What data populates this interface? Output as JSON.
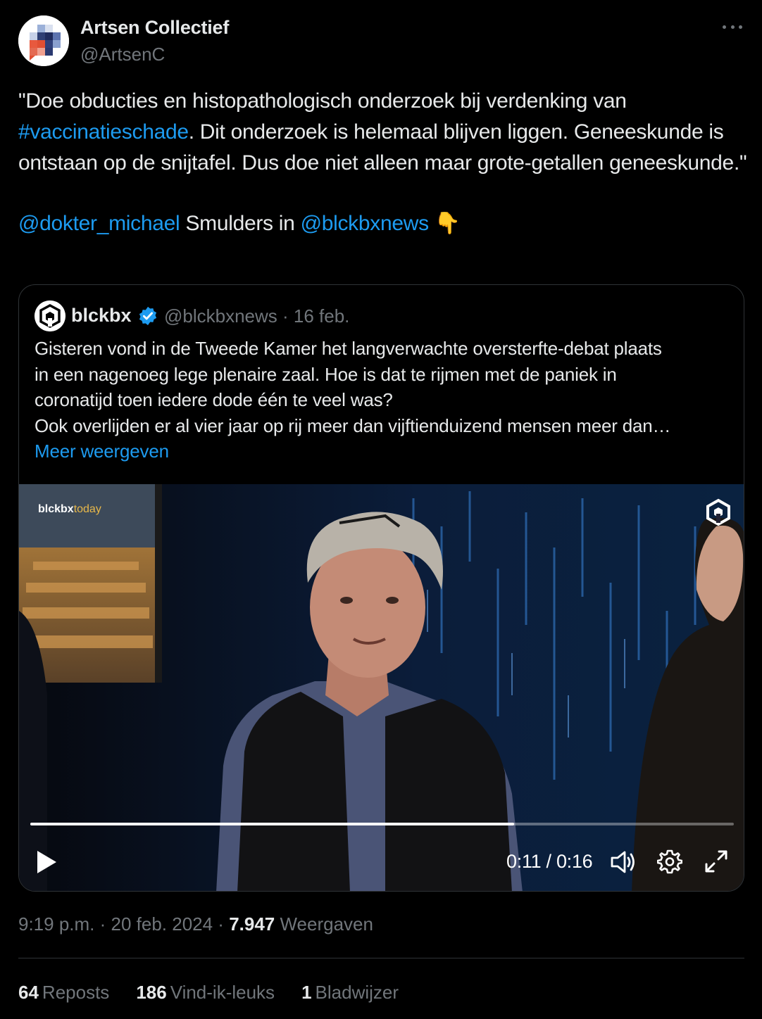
{
  "author": {
    "name": "Artsen Collectief",
    "handle": "@ArtsenC"
  },
  "tweet": {
    "text_before_tag": "\"Doe obducties en histopathologisch onderzoek bij verdenking van ",
    "hashtag": "#vaccinatieschade",
    "text_after_tag": ". Dit onderzoek is helemaal blijven liggen. Geneeskunde is ontstaan op de snijtafel. Dus doe niet alleen maar grote-getallen geneeskunde.\"",
    "mention_1": "@dokter_michael",
    "mention_mid": " Smulders in ",
    "mention_2": "@blckbxnews",
    "emoji": "👇"
  },
  "quoted": {
    "name": "blckbx",
    "handle_date": "@blckbxnews · 16 feb.",
    "lines": [
      "Gisteren vond in de Tweede Kamer het langverwachte oversterfte-debat plaats",
      "in een nagenoeg lege plenaire zaal. Hoe is dat te rijmen met de paniek in",
      "coronatijd toen iedere dode één te veel was?",
      "Ook overlijden er al vier jaar op rij meer dan vijftienduizend mensen meer dan…"
    ],
    "show_more": "Meer weergeven",
    "video": {
      "watermark_brand": "blckbx",
      "watermark_suffix": "today",
      "time": "0:11 / 0:16",
      "progress": 0.6875
    }
  },
  "meta": {
    "time": "9:19 p.m. · 20 feb. 2024 · ",
    "views_count": "7.947",
    "views_label": " Weergaven"
  },
  "stats": {
    "reposts_count": "64",
    "reposts_label": "Reposts",
    "likes_count": "186",
    "likes_label": "Vind-ik-leuks",
    "bookmarks_count": "1",
    "bookmarks_label": "Bladwijzer"
  },
  "colors": {
    "link": "#1d9bf0",
    "muted": "#71767b",
    "text": "#e7e9ea",
    "verified": "#1d9bf0"
  }
}
